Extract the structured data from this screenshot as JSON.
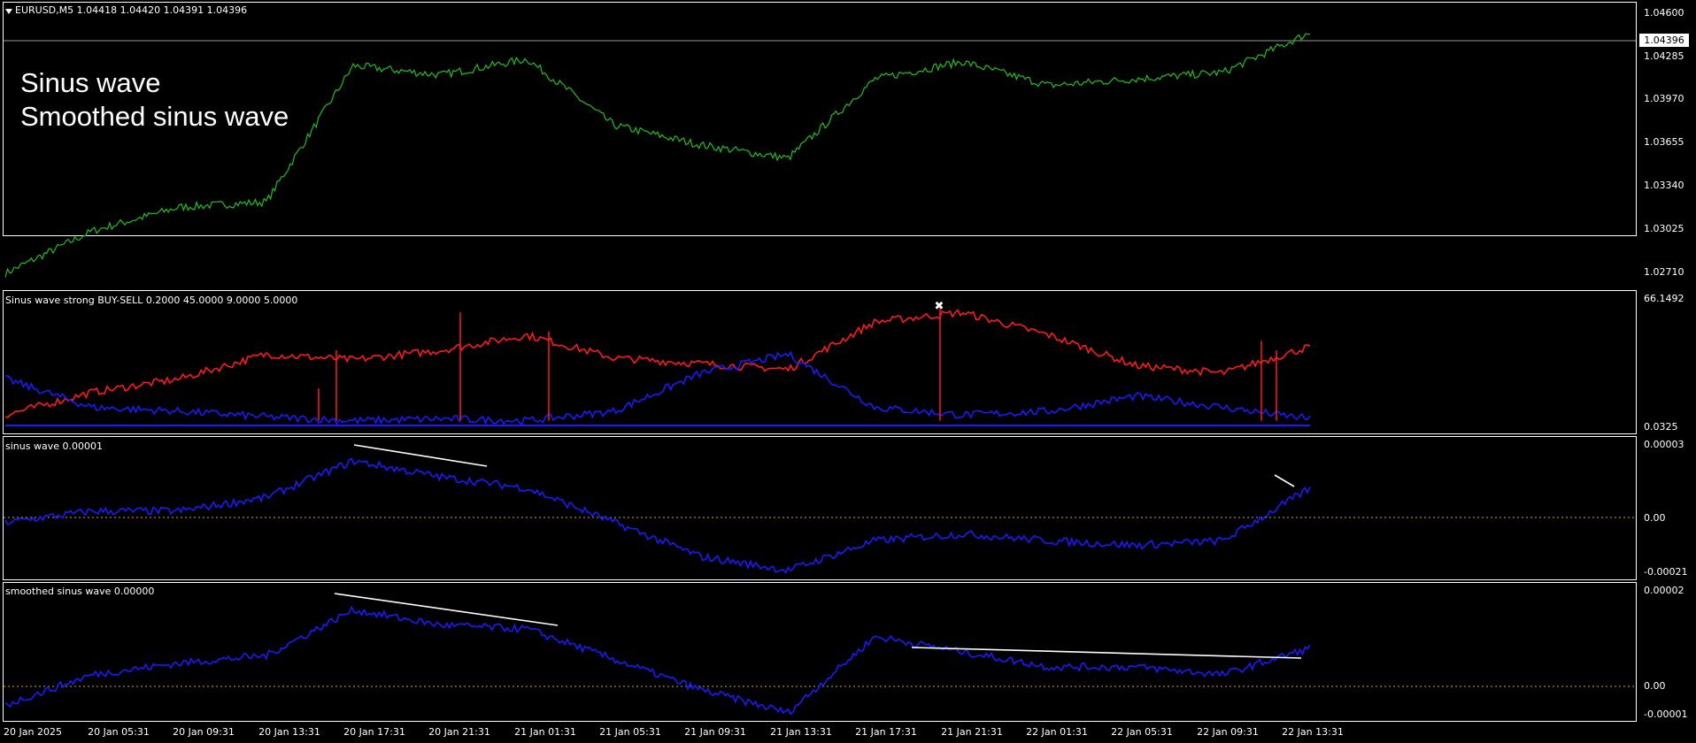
{
  "main_pane": {
    "symbol_header": "EURUSD,M5  1.04418 1.04420 1.04391 1.04396",
    "overlay_line1": "Sinus wave",
    "overlay_line2": "Smoothed sinus wave",
    "price_ticks": [
      "1.04600",
      "1.04285",
      "1.03970",
      "1.03655",
      "1.03340",
      "1.03025",
      "1.02710"
    ],
    "current_price": "1.04396",
    "colors": {
      "price": "#1fbf1f",
      "background": "#000000",
      "border": "#ffffff"
    }
  },
  "indicator1": {
    "title": "Sinus wave strong BUY-SELL 0.2000 45.0000 9.0000 5.0000",
    "tick_top": "66.1492",
    "tick_bottom": "0.0325",
    "colors": {
      "buy": "#ff1a1a",
      "sell": "#1a1aff",
      "marker": "#ffffff"
    }
  },
  "indicator2": {
    "title": "sinus wave 0.00001",
    "ticks": [
      "0.00003",
      "0.00",
      "-0.00021"
    ],
    "colors": {
      "line": "#1a1aff",
      "zero": "#d4a52a",
      "trend": "#ffffff"
    }
  },
  "indicator3": {
    "title": "smoothed sinus wave 0.00000",
    "ticks": [
      "0.00002",
      "0.00",
      "-0.00001"
    ],
    "colors": {
      "line": "#1a1aff",
      "zero": "#d4a52a",
      "trend": "#ffffff"
    }
  },
  "time_axis": [
    "20 Jan 2025",
    "20 Jan 05:31",
    "20 Jan 09:31",
    "20 Jan 13:31",
    "20 Jan 17:31",
    "20 Jan 21:31",
    "21 Jan 01:31",
    "21 Jan 05:31",
    "21 Jan 09:31",
    "21 Jan 13:31",
    "21 Jan 17:31",
    "21 Jan 21:31",
    "22 Jan 01:31",
    "22 Jan 05:31",
    "22 Jan 09:31",
    "22 Jan 13:31"
  ],
  "chart_data": [
    {
      "type": "line",
      "series": [
        {
          "name": "EURUSD,M5",
          "x": [
            "20 Jan 2025",
            "20 Jan 05:31",
            "20 Jan 09:31",
            "20 Jan 13:31",
            "20 Jan 17:31",
            "20 Jan 21:31",
            "21 Jan 01:31",
            "21 Jan 05:31",
            "21 Jan 09:31",
            "21 Jan 13:31",
            "21 Jan 17:31",
            "21 Jan 21:31",
            "22 Jan 01:31",
            "22 Jan 05:31",
            "22 Jan 09:31",
            "22 Jan 13:31"
          ],
          "values": [
            1.0268,
            1.03,
            1.0318,
            1.0322,
            1.0425,
            1.0418,
            1.043,
            1.038,
            1.0365,
            1.0355,
            1.0415,
            1.0428,
            1.041,
            1.0415,
            1.042,
            1.045
          ]
        }
      ],
      "ylim": [
        1.0262,
        1.0468
      ],
      "yticks": [
        1.046,
        1.04285,
        1.0397,
        1.03655,
        1.0334,
        1.03025,
        1.0271
      ]
    },
    {
      "type": "line",
      "series": [
        {
          "x": [
            "20 Jan 2025",
            "20 Jan 05:31",
            "20 Jan 09:31",
            "20 Jan 13:31",
            "20 Jan 17:31",
            "20 Jan 21:31",
            "21 Jan 01:31",
            "21 Jan 05:31",
            "21 Jan 09:31",
            "21 Jan 13:31",
            "21 Jan 17:31",
            "21 Jan 21:31",
            "22 Jan 01:31",
            "22 Jan 05:31",
            "22 Jan 09:31",
            "22 Jan 13:31"
          ],
          "values": [
            6,
            18,
            25,
            38,
            35,
            40,
            48,
            36,
            33,
            30,
            55,
            60,
            48,
            32,
            28,
            42
          ]
        },
        {
          "x": [
            "20 Jan 2025",
            "20 Jan 05:31",
            "20 Jan 09:31",
            "20 Jan 13:31",
            "20 Jan 17:31",
            "20 Jan 21:31",
            "21 Jan 01:31",
            "21 Jan 05:31",
            "21 Jan 09:31",
            "21 Jan 13:31",
            "21 Jan 17:31",
            "21 Jan 21:31",
            "22 Jan 01:31",
            "22 Jan 05:31",
            "22 Jan 09:31",
            "22 Jan 13:31"
          ],
          "values": [
            25,
            10,
            8,
            5,
            3,
            4,
            3,
            8,
            28,
            38,
            10,
            6,
            8,
            16,
            10,
            4
          ]
        }
      ],
      "ylim": [
        0.0325,
        66.1492
      ]
    },
    {
      "type": "line",
      "series": [
        {
          "x": [
            "20 Jan 2025",
            "20 Jan 05:31",
            "20 Jan 09:31",
            "20 Jan 13:31",
            "20 Jan 17:31",
            "20 Jan 21:31",
            "21 Jan 01:31",
            "21 Jan 05:31",
            "21 Jan 09:31",
            "21 Jan 13:31",
            "21 Jan 17:31",
            "21 Jan 21:31",
            "22 Jan 01:31",
            "22 Jan 05:31",
            "22 Jan 09:31",
            "22 Jan 13:31"
          ],
          "values": [
            0.0,
            5e-06,
            5e-06,
            1.1e-05,
            2.7e-05,
            2e-05,
            1.5e-05,
            0.0,
            -1.5e-05,
            -2.1e-05,
            -8e-06,
            -5e-06,
            -8e-06,
            -1e-05,
            -8e-06,
            1.5e-05
          ]
        }
      ],
      "ylim": [
        -2.3e-05,
        3.4e-05
      ]
    },
    {
      "type": "line",
      "series": [
        {
          "x": [
            "20 Jan 2025",
            "20 Jan 05:31",
            "20 Jan 09:31",
            "20 Jan 13:31",
            "20 Jan 17:31",
            "20 Jan 21:31",
            "21 Jan 01:31",
            "21 Jan 05:31",
            "21 Jan 09:31",
            "21 Jan 13:31",
            "21 Jan 17:31",
            "21 Jan 21:31",
            "22 Jan 01:31",
            "22 Jan 05:31",
            "22 Jan 09:31",
            "22 Jan 13:31"
          ],
          "values": [
            -8e-06,
            0.0,
            3e-06,
            5e-06,
            1.7e-05,
            1.3e-05,
            1.2e-05,
            4e-06,
            -4e-06,
            -1e-05,
            1e-05,
            6e-06,
            2e-06,
            2e-06,
            0.0,
            7e-06
          ]
        }
      ],
      "ylim": [
        -1.1e-05,
        2.2e-05
      ]
    }
  ]
}
